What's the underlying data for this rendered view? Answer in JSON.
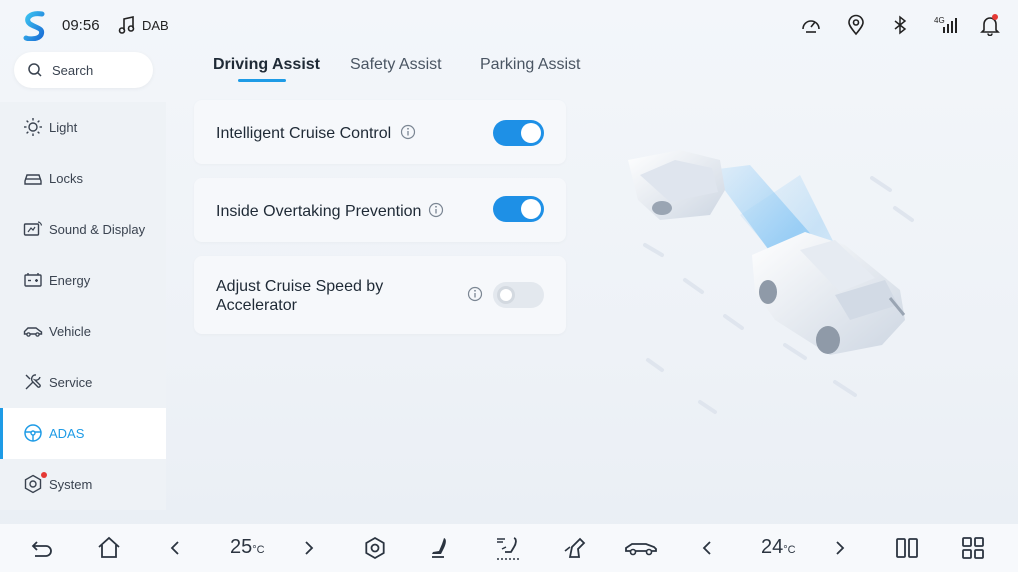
{
  "status_bar": {
    "time": "09:56",
    "media_source": "DAB",
    "icons": [
      "logo-icon",
      "music-note-icon",
      "speedometer-icon",
      "location-pin-icon",
      "bluetooth-icon",
      "4g-signal-icon",
      "notification-bell-icon"
    ],
    "signal_label": "4G"
  },
  "sidebar": {
    "search_placeholder": "Search",
    "items": [
      {
        "label": "Light",
        "icon": "light-icon"
      },
      {
        "label": "Locks",
        "icon": "locks-icon"
      },
      {
        "label": "Sound & Display",
        "icon": "sound-display-icon"
      },
      {
        "label": "Energy",
        "icon": "energy-icon"
      },
      {
        "label": "Vehicle",
        "icon": "vehicle-icon"
      },
      {
        "label": "Service",
        "icon": "service-icon"
      },
      {
        "label": "ADAS",
        "icon": "steering-wheel-icon",
        "active": true
      },
      {
        "label": "System",
        "icon": "system-icon",
        "badge": true
      }
    ]
  },
  "tabs": [
    {
      "label": "Driving Assist",
      "active": true
    },
    {
      "label": "Safety Assist"
    },
    {
      "label": "Parking Assist"
    }
  ],
  "settings": [
    {
      "label": "Intelligent Cruise Control",
      "enabled": true
    },
    {
      "label": "Inside Overtaking Prevention",
      "enabled": true
    },
    {
      "label_line1": "Adjust Cruise Speed by",
      "label_line2": "Accelerator",
      "enabled": false
    }
  ],
  "dock": {
    "left_temp": "25",
    "right_temp": "24",
    "temp_unit": "°C",
    "icons": [
      "back-icon",
      "home-icon",
      "temp-decrease-left-icon",
      "temp-increase-left-icon",
      "settings-gear-icon",
      "seat-icon",
      "airflow-icon",
      "seat-heat-icon",
      "car-icon",
      "temp-decrease-right-icon",
      "temp-increase-right-icon",
      "split-screen-icon",
      "app-grid-icon"
    ]
  },
  "colors": {
    "accent": "#1e9be6",
    "toggle_on": "#1e90e6",
    "badge": "#e53935"
  }
}
